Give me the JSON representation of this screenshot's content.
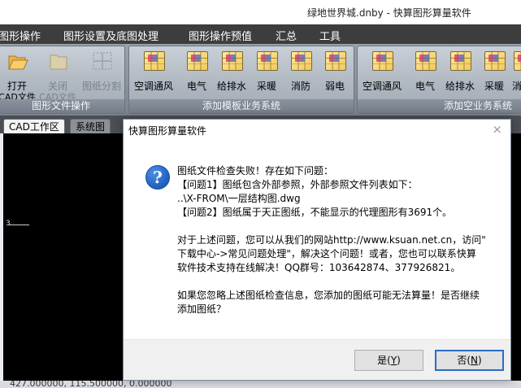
{
  "window": {
    "title": "绿地世界城.dnby - 快算图形算量软件"
  },
  "menu": [
    "图形操作",
    "图形设置及底图处理",
    "图形操作预值",
    "汇总",
    "工具"
  ],
  "ribbon": {
    "file_group": {
      "title": "图形文件操作",
      "open": {
        "label": "打开",
        "sub": "CAD文件"
      },
      "close": {
        "label": "关闭",
        "sub": "CAD文件"
      },
      "split": {
        "label": "图纸分割"
      }
    },
    "template_group": {
      "title": "添加模板业务系统",
      "items": [
        "空调通风",
        "电气",
        "给排水",
        "采暖",
        "消防",
        "弱电"
      ]
    },
    "empty_group": {
      "title": "添加空业务系统",
      "items": [
        "空调通风",
        "电气",
        "给排水",
        "采暖",
        "消"
      ]
    }
  },
  "tabs": [
    "CAD工作区",
    "系统图"
  ],
  "canvas": {
    "axis_label": "3"
  },
  "status": {
    "coords": "427.000000, 115.500000, 0.000000"
  },
  "dialog": {
    "title": "快算图形算量软件",
    "close": "×",
    "icon": "question-icon",
    "lines": [
      "图纸文件检查失败！存在如下问题：",
      "【问题1】图纸包含外部参照，外部参照文件列表如下：",
      "..\\X-FROM\\一层结构图.dwg",
      "【问题2】图纸属于天正图纸，不能显示的代理图形有3691个。",
      "",
      "对于上述问题，您可以从我们的网站http://www.ksuan.net.cn，访问\"",
      "下载中心->常见问题处理\"，解决这个问题！或者，您也可以联系快算",
      "软件技术支持在线解决！QQ群号：103642874、377926821。",
      "",
      "如果您忽略上述图纸检查信息，您添加的图纸可能无法算量！是否继续",
      "添加图纸？"
    ],
    "yes": {
      "text": "是(",
      "key": "Y",
      "end": ")"
    },
    "no": {
      "text": "否(",
      "key": "N",
      "end": ")"
    }
  }
}
